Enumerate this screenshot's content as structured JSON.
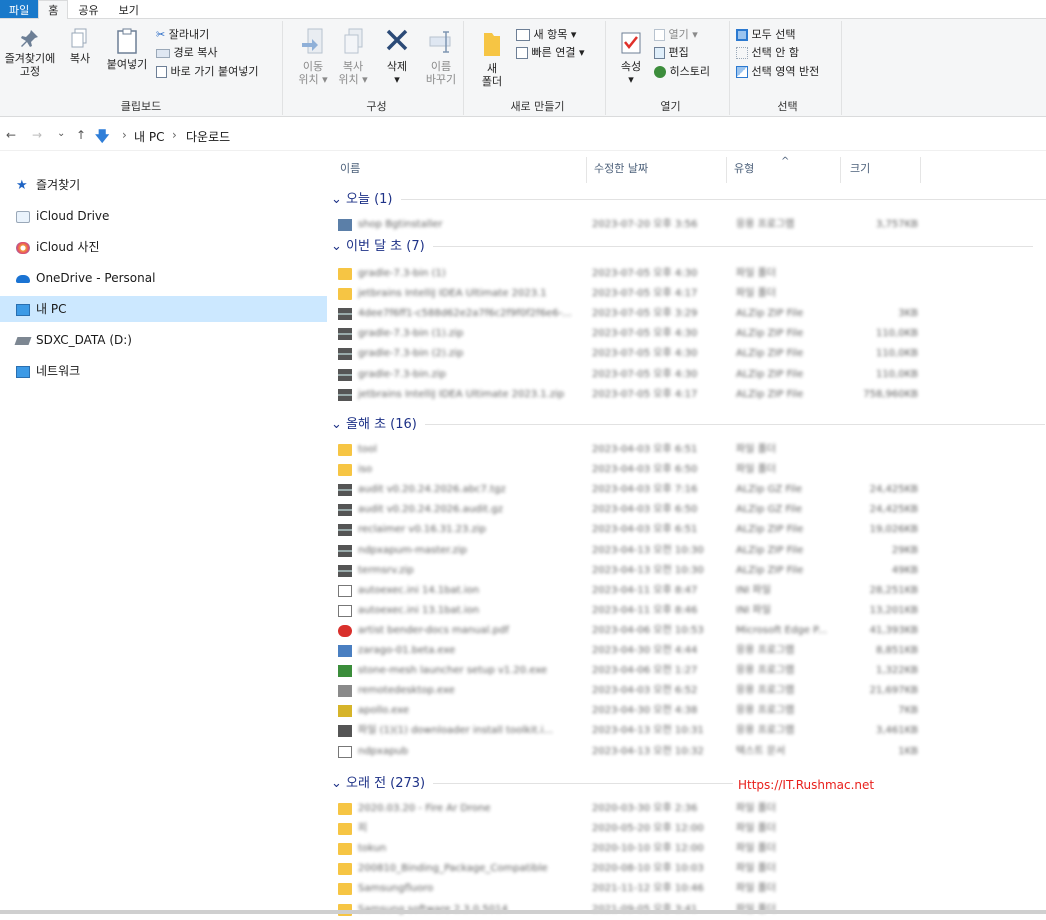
{
  "tabs": [
    {
      "label": "파일"
    },
    {
      "label": "홈"
    },
    {
      "label": "공유"
    },
    {
      "label": "보기"
    }
  ],
  "ribbon": {
    "clipboard": {
      "pin_label_1": "즐겨찾기에",
      "pin_label_2": "고정",
      "copy": "복사",
      "paste": "붙여넣기",
      "cut": "잘라내기",
      "copy_path": "경로 복사",
      "paste_shortcut": "바로 가기 붙여넣기",
      "group": "클립보드"
    },
    "organize": {
      "move_1": "이동",
      "move_2": "위치",
      "copy_1": "복사",
      "copy_2": "위치",
      "delete": "삭제",
      "rename_1": "이름",
      "rename_2": "바꾸기",
      "group": "구성"
    },
    "new": {
      "folder_1": "새",
      "folder_2": "폴더",
      "new_item": "새 항목",
      "easy_access": "빠른 연결",
      "group": "새로 만들기"
    },
    "open": {
      "properties": "속성",
      "open": "열기",
      "edit": "편집",
      "history": "히스토리",
      "group": "열기"
    },
    "select": {
      "select_all": "모두 선택",
      "select_none": "선택 안 함",
      "invert": "선택 영역 반전",
      "group": "선택"
    }
  },
  "address": {
    "back": "←",
    "forward": "→",
    "recent": "⌄",
    "up": "↑",
    "path": [
      "내 PC",
      "다운로드"
    ],
    "sep": "›"
  },
  "nav": [
    {
      "label": "즐겨찾기",
      "icon": "star-icon"
    },
    {
      "label": "iCloud Drive",
      "icon": "icloud-icon"
    },
    {
      "label": "iCloud 사진",
      "icon": "photos-icon"
    },
    {
      "label": "OneDrive - Personal",
      "icon": "onedrive-icon"
    },
    {
      "label": "내 PC",
      "icon": "pc-icon"
    },
    {
      "label": "SDXC_DATA (D:)",
      "icon": "drive-icon"
    },
    {
      "label": "네트워크",
      "icon": "network-icon"
    }
  ],
  "columns": {
    "name": "이름",
    "date": "수정한 날짜",
    "type": "유형",
    "size": "크기",
    "sort": "^"
  },
  "groups": [
    {
      "label": "오늘 (1)",
      "rows": [
        {
          "icon": "file-icon",
          "name": "shop Bgtinstaller",
          "date": "2023-07-20 오후 3:56",
          "type": "응용 프로그램",
          "size": "3,757KB"
        }
      ]
    },
    {
      "label": "이번 달 초 (7)",
      "rows": [
        {
          "icon": "folder-icon",
          "name": "gradle-7.3-bin (1)",
          "date": "2023-07-05 오후 4:30",
          "type": "파일 폴더",
          "size": ""
        },
        {
          "icon": "folder-icon",
          "name": "jetbrains IntelliJ IDEA Ultimate 2023.1",
          "date": "2023-07-05 오후 4:17",
          "type": "파일 폴더",
          "size": ""
        },
        {
          "icon": "zip-icon",
          "name": "4dee7f6ff1-c588d62e2a7f6c2f9f0f2f6e6-...",
          "date": "2023-07-05 오후 3:29",
          "type": "ALZip ZIP File",
          "size": "3KB"
        },
        {
          "icon": "zip-icon",
          "name": "gradle-7.3-bin (1).zip",
          "date": "2023-07-05 오후 4:30",
          "type": "ALZip ZIP File",
          "size": "110,0KB"
        },
        {
          "icon": "zip-icon",
          "name": "gradle-7.3-bin (2).zip",
          "date": "2023-07-05 오후 4:30",
          "type": "ALZip ZIP File",
          "size": "110,0KB"
        },
        {
          "icon": "zip-icon",
          "name": "gradle-7.3-bin.zip",
          "date": "2023-07-05 오후 4:30",
          "type": "ALZip ZIP File",
          "size": "110,0KB"
        },
        {
          "icon": "zip-icon",
          "name": "jetbrains IntelliJ IDEA Ultimate 2023.1.zip",
          "date": "2023-07-05 오후 4:17",
          "type": "ALZip ZIP File",
          "size": "758,960KB"
        }
      ]
    },
    {
      "label": "올해 초 (16)",
      "rows": [
        {
          "icon": "folder-icon",
          "name": "tool",
          "date": "2023-04-03 오후 6:51",
          "type": "파일 폴더",
          "size": ""
        },
        {
          "icon": "folder-icon",
          "name": "iso",
          "date": "2023-04-03 오후 6:50",
          "type": "파일 폴더",
          "size": ""
        },
        {
          "icon": "zip-icon",
          "name": "audit v0.20.24.2026.abc7.tgz",
          "date": "2023-04-03 오후 7:16",
          "type": "ALZip GZ File",
          "size": "24,425KB"
        },
        {
          "icon": "zip-icon",
          "name": "audit v0.20.24.2026.audit.gz",
          "date": "2023-04-03 오후 6:50",
          "type": "ALZip GZ File",
          "size": "24,425KB"
        },
        {
          "icon": "zip-icon",
          "name": "reclaimer v0.16.31.23.zip",
          "date": "2023-04-03 오후 6:51",
          "type": "ALZip ZIP File",
          "size": "19,026KB"
        },
        {
          "icon": "zip-icon",
          "name": "ndpxapum-master.zip",
          "date": "2023-04-13 오전 10:30",
          "type": "ALZip ZIP File",
          "size": "29KB"
        },
        {
          "icon": "zip-icon",
          "name": "termsrv.zip",
          "date": "2023-04-13 오전 10:30",
          "type": "ALZip ZIP File",
          "size": "49KB"
        },
        {
          "icon": "txt-icon",
          "name": "autoexec.ini 14.1bat.ion",
          "date": "2023-04-11 오후 8:47",
          "type": "INI 파일",
          "size": "28,251KB"
        },
        {
          "icon": "txt-icon",
          "name": "autoexec.ini 13.1bat.ion",
          "date": "2023-04-11 오후 8:46",
          "type": "INI 파일",
          "size": "13,201KB"
        },
        {
          "icon": "pdf-icon",
          "name": "artist bender-docs manual.pdf",
          "date": "2023-04-06 오전 10:53",
          "type": "Microsoft Edge P...",
          "size": "41,393KB"
        },
        {
          "icon": "exe-icon",
          "name": "zarago-01.beta.exe",
          "date": "2023-04-30 오전 4:44",
          "type": "응용 프로그램",
          "size": "8,851KB"
        },
        {
          "icon": "exe2-icon",
          "name": "stone-mesh launcher setup v1.20.exe",
          "date": "2023-04-06 오전 1:27",
          "type": "응용 프로그램",
          "size": "1,322KB"
        },
        {
          "icon": "exe3-icon",
          "name": "remotedesktop.exe",
          "date": "2023-04-03 오전 6:52",
          "type": "응용 프로그램",
          "size": "21,697KB"
        },
        {
          "icon": "exe4-icon",
          "name": "apollo.exe",
          "date": "2023-04-30 오전 4:38",
          "type": "응용 프로그램",
          "size": "7KB"
        },
        {
          "icon": "exe5-icon",
          "name": "파일 (1)(1) downloader install toolkit.i...",
          "date": "2023-04-13 오전 10:31",
          "type": "응용 프로그램",
          "size": "3,461KB"
        },
        {
          "icon": "txt-icon",
          "name": "ndpxapub",
          "date": "2023-04-13 오전 10:32",
          "type": "텍스트 문서",
          "size": "1KB"
        }
      ]
    },
    {
      "label": "오래 전 (273)",
      "rows": [
        {
          "icon": "folder-icon",
          "name": "2020.03.20 - Fire Ar Drone",
          "date": "2020-03-30 오후 2:36",
          "type": "파일 폴더",
          "size": ""
        },
        {
          "icon": "folder-icon",
          "name": "피",
          "date": "2020-05-20 오후 12:00",
          "type": "파일 폴더",
          "size": ""
        },
        {
          "icon": "folder-icon",
          "name": "tokun",
          "date": "2020-10-10 오후 12:00",
          "type": "파일 폴더",
          "size": ""
        },
        {
          "icon": "folder-icon",
          "name": "200810_Binding_Package_Compatible",
          "date": "2020-08-10 오후 10:03",
          "type": "파일 폴더",
          "size": ""
        },
        {
          "icon": "folder-icon",
          "name": "Samsungfluoro",
          "date": "2021-11-12 오후 10:46",
          "type": "파일 폴더",
          "size": ""
        },
        {
          "icon": "folder-icon",
          "name": "Samsung software 2.3.0.5014",
          "date": "2021-09-05 오후 3:41",
          "type": "파일 폴더",
          "size": ""
        }
      ]
    }
  ],
  "watermark": "Https://IT.Rushmac.net",
  "colors": {
    "file_tab": "#1979ca",
    "selected": "#cce8ff",
    "group_header": "#1e3287",
    "folder": "#f6c544",
    "watermark": "#e8201c"
  }
}
